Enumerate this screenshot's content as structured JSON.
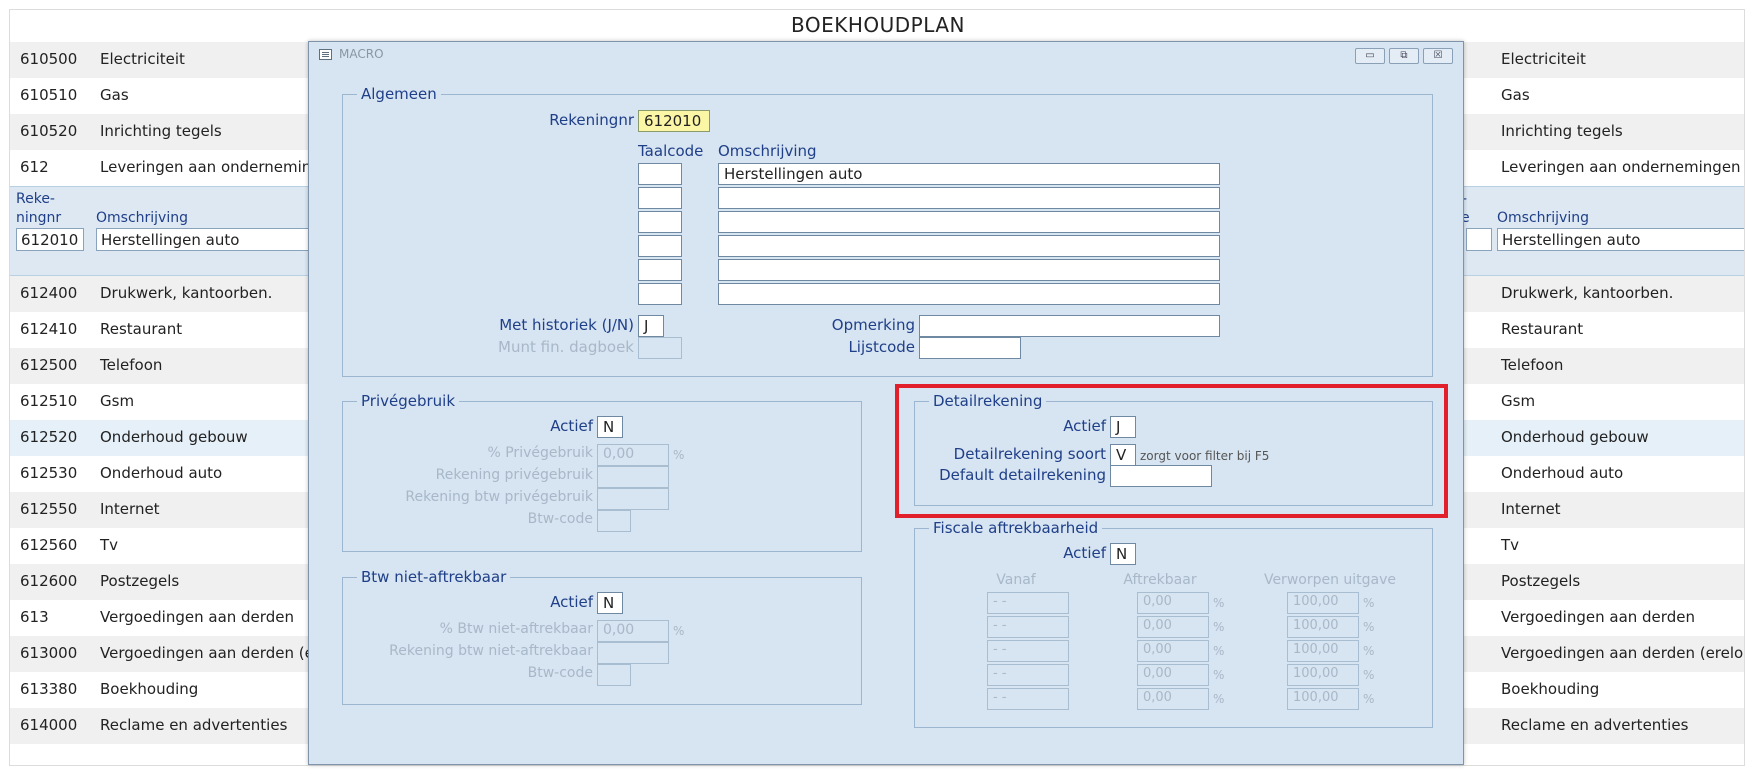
{
  "page_title": "BOEKHOUDPLAN",
  "background_rows": [
    {
      "code": "610500",
      "desc": "Electriciteit",
      "rdesc": "Electriciteit"
    },
    {
      "code": "610510",
      "desc": "Gas",
      "rdesc": "Gas"
    },
    {
      "code": "610520",
      "desc": "Inrichting tegels",
      "rdesc": "Inrichting tegels"
    },
    {
      "code": "612",
      "desc": "Leveringen aan ondernemingen",
      "rdesc": "Leveringen aan ondernemingen"
    }
  ],
  "selected_row": {
    "header_code": "Reke-\nningnr",
    "header_desc": "Omschrijving",
    "right_header_fragment": "e",
    "right_header_top": "-",
    "code": "612010",
    "desc": "Herstellingen auto",
    "rdesc": "Herstellingen auto"
  },
  "background_rows_2": [
    {
      "code": "612400",
      "desc": "Drukwerk, kantoorben.",
      "rdesc": "Drukwerk, kantoorben."
    },
    {
      "code": "612410",
      "desc": "Restaurant",
      "rdesc": "Restaurant"
    },
    {
      "code": "612500",
      "desc": "Telefoon",
      "rdesc": "Telefoon"
    },
    {
      "code": "612510",
      "desc": "Gsm",
      "rdesc": "Gsm"
    },
    {
      "code": "612520",
      "desc": "Onderhoud gebouw",
      "rdesc": "Onderhoud gebouw"
    },
    {
      "code": "612530",
      "desc": "Onderhoud auto",
      "rdesc": "Onderhoud auto"
    },
    {
      "code": "612550",
      "desc": "Internet",
      "rdesc": "Internet"
    },
    {
      "code": "612560",
      "desc": "Tv",
      "rdesc": "Tv"
    },
    {
      "code": "612600",
      "desc": "Postzegels",
      "rdesc": "Postzegels"
    },
    {
      "code": "613",
      "desc": "Vergoedingen aan derden",
      "rdesc": "Vergoedingen aan derden"
    },
    {
      "code": "613000",
      "desc": "Vergoedingen aan derden (ereloon,",
      "rdesc": "Vergoedingen aan derden (ereloon,"
    },
    {
      "code": "613380",
      "desc": "Boekhouding",
      "rdesc": "Boekhouding"
    },
    {
      "code": "614000",
      "desc": "Reclame en advertenties",
      "rdesc": "Reclame en advertenties"
    }
  ],
  "dialog": {
    "title": "MACRO",
    "buttons": {
      "minimize": "▭",
      "restore": "⧉",
      "close": "☒"
    },
    "algemeen": {
      "legend": "Algemeen",
      "rekeningnr_label": "Rekeningnr",
      "rekeningnr_value": "612010",
      "taalcode_header": "Taalcode",
      "omschrijving_header": "Omschrijving",
      "omschrijvingen": [
        "Herstellingen auto",
        "",
        "",
        "",
        "",
        ""
      ],
      "historiek_label": "Met historiek (J/N)",
      "historiek_value": "J",
      "munt_label": "Munt fin. dagboek",
      "opmerking_label": "Opmerking",
      "lijstcode_label": "Lijstcode"
    },
    "privegebruik": {
      "legend": "Privégebruik",
      "actief_label": "Actief",
      "actief_value": "N",
      "pct_label": "% Privégebruik",
      "pct_value": "0,00",
      "pct_sign": "%",
      "rekening_label": "Rekening privégebruik",
      "rekening_btw_label": "Rekening btw privégebruik",
      "btwcode_label": "Btw-code"
    },
    "btw_niet": {
      "legend": "Btw niet-aftrekbaar",
      "actief_label": "Actief",
      "actief_value": "N",
      "pct_label": "% Btw niet-aftrekbaar",
      "pct_value": "0,00",
      "pct_sign": "%",
      "rekening_label": "Rekening btw niet-aftrekbaar",
      "btwcode_label": "Btw-code"
    },
    "detailrekening": {
      "legend": "Detailrekening",
      "actief_label": "Actief",
      "actief_value": "J",
      "soort_label": "Detailrekening soort",
      "soort_value": "V",
      "soort_note": "zorgt voor filter bij F5",
      "default_label": "Default detailrekening"
    },
    "fiscale": {
      "legend": "Fiscale aftrekbaarheid",
      "actief_label": "Actief",
      "actief_value": "N",
      "col_vanaf": "Vanaf",
      "col_aftrekbaar": "Aftrekbaar",
      "col_verworpen": "Verworpen uitgave",
      "rows": [
        {
          "vanaf": "- -",
          "aftrekbaar": "0,00",
          "verworpen": "100,00"
        },
        {
          "vanaf": "- -",
          "aftrekbaar": "0,00",
          "verworpen": "100,00"
        },
        {
          "vanaf": "- -",
          "aftrekbaar": "0,00",
          "verworpen": "100,00"
        },
        {
          "vanaf": "- -",
          "aftrekbaar": "0,00",
          "verworpen": "100,00"
        },
        {
          "vanaf": "- -",
          "aftrekbaar": "0,00",
          "verworpen": "100,00"
        }
      ],
      "pct_sign": "%"
    }
  },
  "colors": {
    "highlight_box": "#e2202c",
    "dialog_bg": "#d7e4f1",
    "label": "#1f3f88",
    "yellow_field": "#fbf6a6"
  }
}
